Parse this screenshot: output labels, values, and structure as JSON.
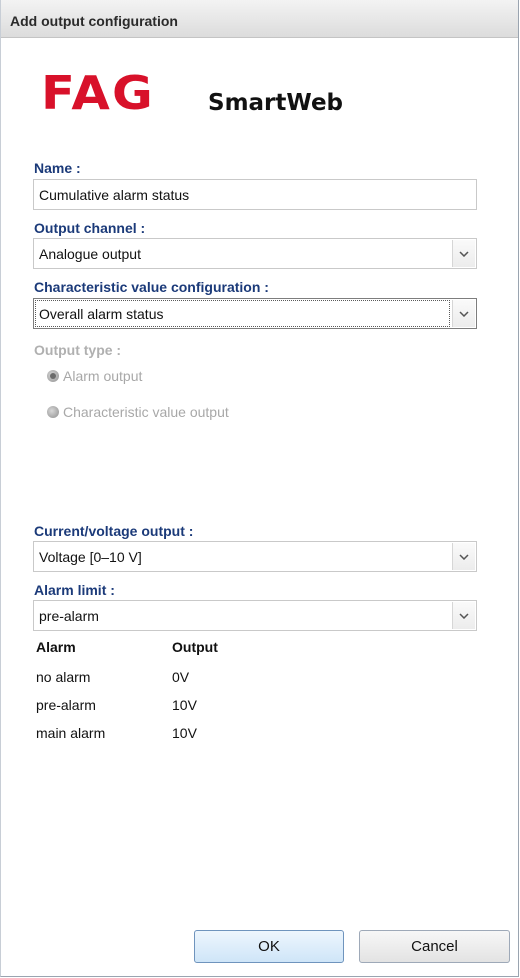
{
  "dialog": {
    "title": "Add output configuration"
  },
  "logo": {
    "brand": "FAG",
    "product": "SmartWeb"
  },
  "name": {
    "label": "Name :",
    "value": "Cumulative alarm status"
  },
  "output_channel": {
    "label": "Output channel :",
    "value": "Analogue output"
  },
  "characteristic": {
    "label": "Characteristic value configuration :",
    "value": "Overall alarm status"
  },
  "output_type": {
    "label": "Output type :",
    "options": [
      "Alarm output",
      "Characteristic value output"
    ],
    "selected": "Alarm output"
  },
  "current_voltage": {
    "label": "Current/voltage output :",
    "value": "Voltage [0–10 V]"
  },
  "alarm_limit": {
    "label": "Alarm limit :",
    "value": "pre-alarm"
  },
  "table": {
    "headers": [
      "Alarm",
      "Output"
    ],
    "rows": [
      [
        "no alarm",
        "0V"
      ],
      [
        "pre-alarm",
        "10V"
      ],
      [
        "main alarm",
        "10V"
      ]
    ]
  },
  "buttons": {
    "ok": "OK",
    "cancel": "Cancel"
  },
  "colors": {
    "brand_red": "#d8112a",
    "label_blue": "#1b3a79",
    "disabled": "#b0b0b0"
  }
}
